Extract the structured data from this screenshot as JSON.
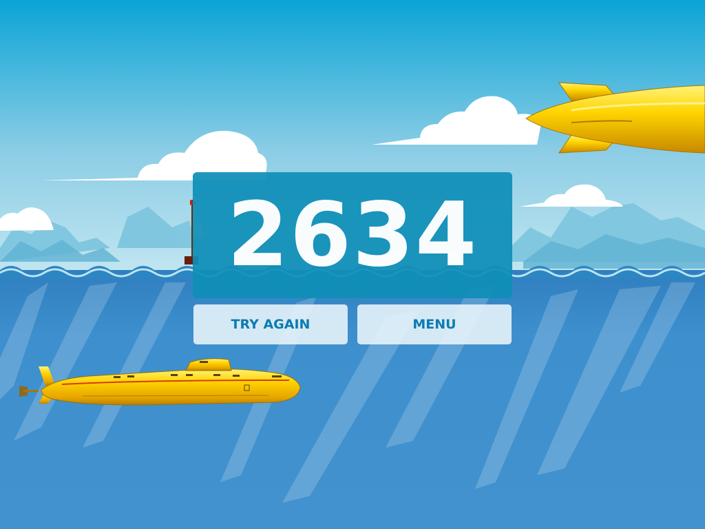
{
  "game": {
    "score": "2634",
    "buttons": {
      "try_again_label": "TRY AGAIN",
      "menu_label": "MENU"
    }
  },
  "colors": {
    "sky_top": "#0aa4d6",
    "sky_horizon": "#c2e6f1",
    "water": "#3f90cd",
    "panel": "#0f8fb8",
    "button_text": "#0d7bb0",
    "submarine_yellow": "#f5c700"
  },
  "icons": {
    "submarine": "submarine-icon",
    "torpedo": "torpedo-icon",
    "ship": "ship-icon"
  }
}
